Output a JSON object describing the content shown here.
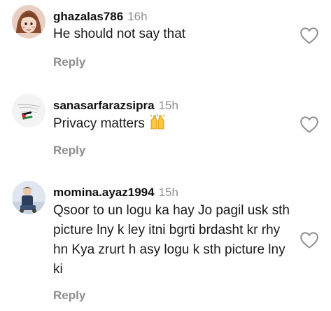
{
  "comments": [
    {
      "username": "ghazalas786",
      "time": "16h",
      "text": "He should not say that",
      "reply_label": "Reply",
      "emoji": ""
    },
    {
      "username": "sanasarfarazsipra",
      "time": "15h",
      "text": "Privacy matters",
      "reply_label": "Reply",
      "emoji": "raising-hands-emoji"
    },
    {
      "username": "momina.ayaz1994",
      "time": "15h",
      "text": "Qsoor to un logu ka hay Jo pagil usk sth picture lny k ley itni bgrti brdasht kr rhy hn Kya zrurt h asy logu k sth picture lny ki",
      "reply_label": "Reply",
      "emoji": ""
    }
  ],
  "icons": {
    "like": "heart-outline-icon"
  },
  "colors": {
    "muted": "#8e8e8e",
    "text": "#111111"
  }
}
